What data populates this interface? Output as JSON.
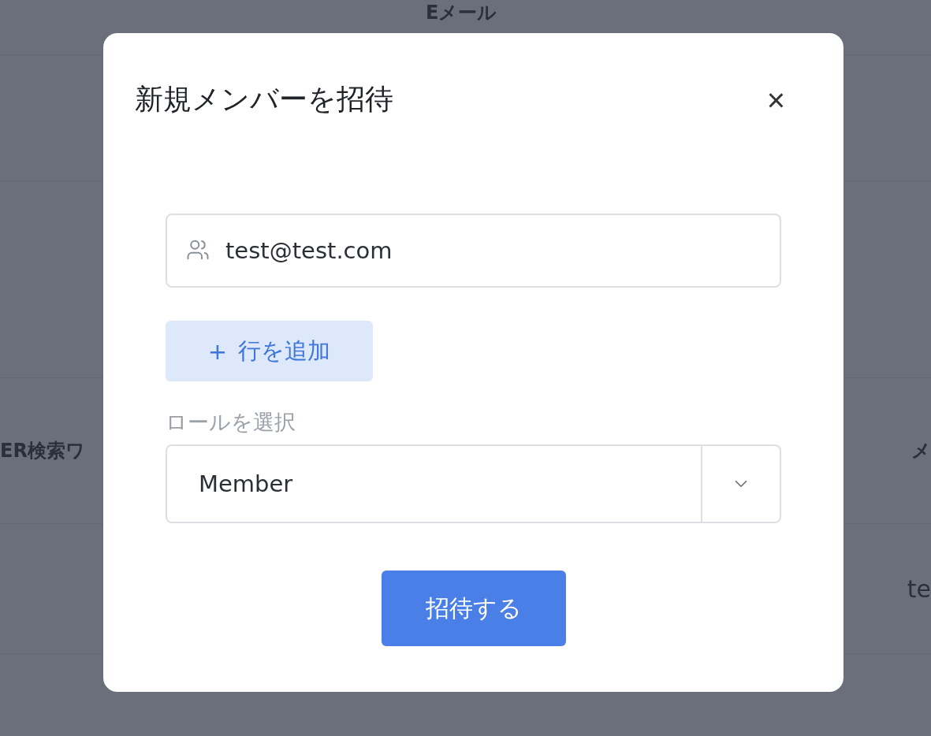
{
  "background": {
    "top_header": "Eメール",
    "headers": [
      "ER検索ワ",
      "メ"
    ],
    "cell": "te"
  },
  "dialog": {
    "title": "新規メンバーを招待",
    "close": "×",
    "email_field": {
      "value": "test@test.com"
    },
    "add_row_button": {
      "icon": "+",
      "label": "行を追加"
    },
    "role_label": "ロールを選択",
    "role_select": {
      "value": "Member"
    },
    "submit_button": "招待する"
  }
}
